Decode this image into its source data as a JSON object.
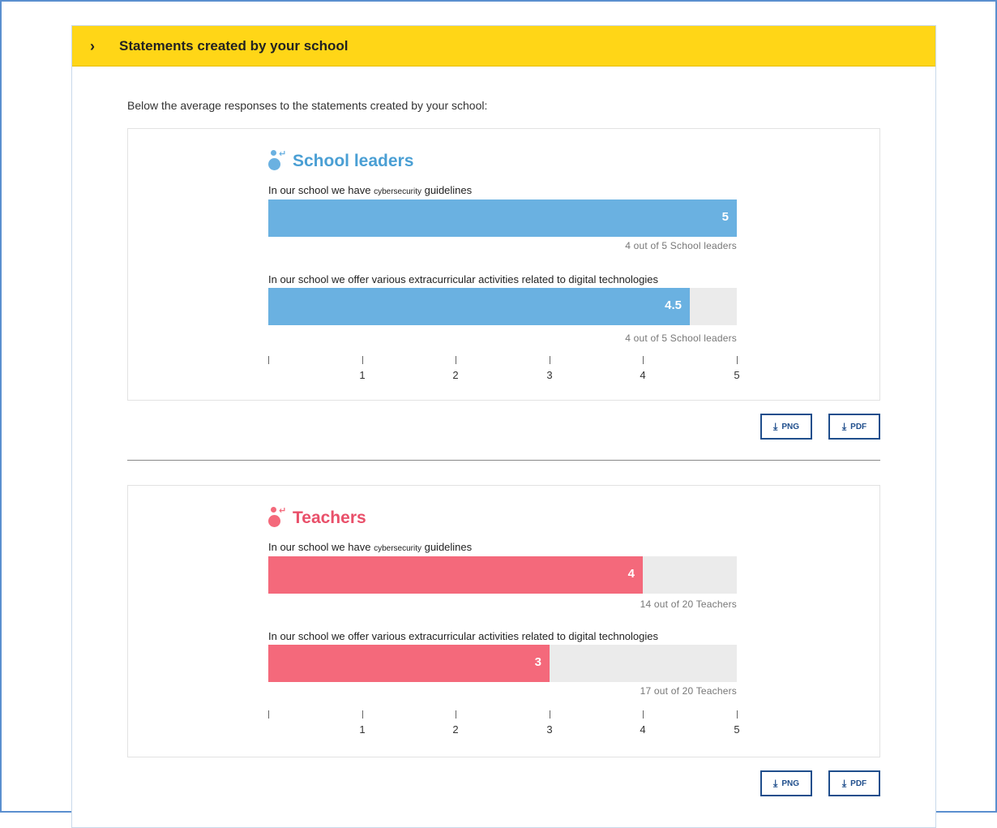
{
  "panel": {
    "title": "Statements created by your school",
    "intro": "Below the average responses to the statements created by your school:"
  },
  "colors": {
    "leaders": "#6ab1e1",
    "teachers": "#f4697b",
    "header": "#ffd617",
    "button": "#1f4e8c"
  },
  "groups": [
    {
      "title": "School leaders",
      "icon": "person-group-icon",
      "statements": [
        {
          "pre": "In our school we have ",
          "small": "cybersecurity",
          "post": " guidelines",
          "value_label": "5",
          "value": 5,
          "count": "4 out of 5 School leaders"
        },
        {
          "pre": "In our school we offer various extracurricular activities related to digital technologies",
          "small": "",
          "post": "",
          "value_label": "4.5",
          "value": 4.5,
          "count": "4 out of 5 School leaders"
        }
      ],
      "axis_ticks": [
        "",
        "1",
        "2",
        "3",
        "4",
        "5"
      ],
      "buttons": {
        "png": "PNG",
        "pdf": "PDF"
      }
    },
    {
      "title": "Teachers",
      "icon": "person-group-icon",
      "statements": [
        {
          "pre": "In our school we have ",
          "small": "cybersecurity",
          "post": " guidelines",
          "value_label": "4",
          "value": 4,
          "count": "14 out of 20 Teachers"
        },
        {
          "pre": "In our school we offer various extracurricular activities related to digital technologies",
          "small": "",
          "post": "",
          "value_label": "3",
          "value": 3,
          "count": "17 out of 20 Teachers"
        }
      ],
      "axis_ticks": [
        "",
        "1",
        "2",
        "3",
        "4",
        "5"
      ],
      "buttons": {
        "png": "PNG",
        "pdf": "PDF"
      }
    }
  ]
}
